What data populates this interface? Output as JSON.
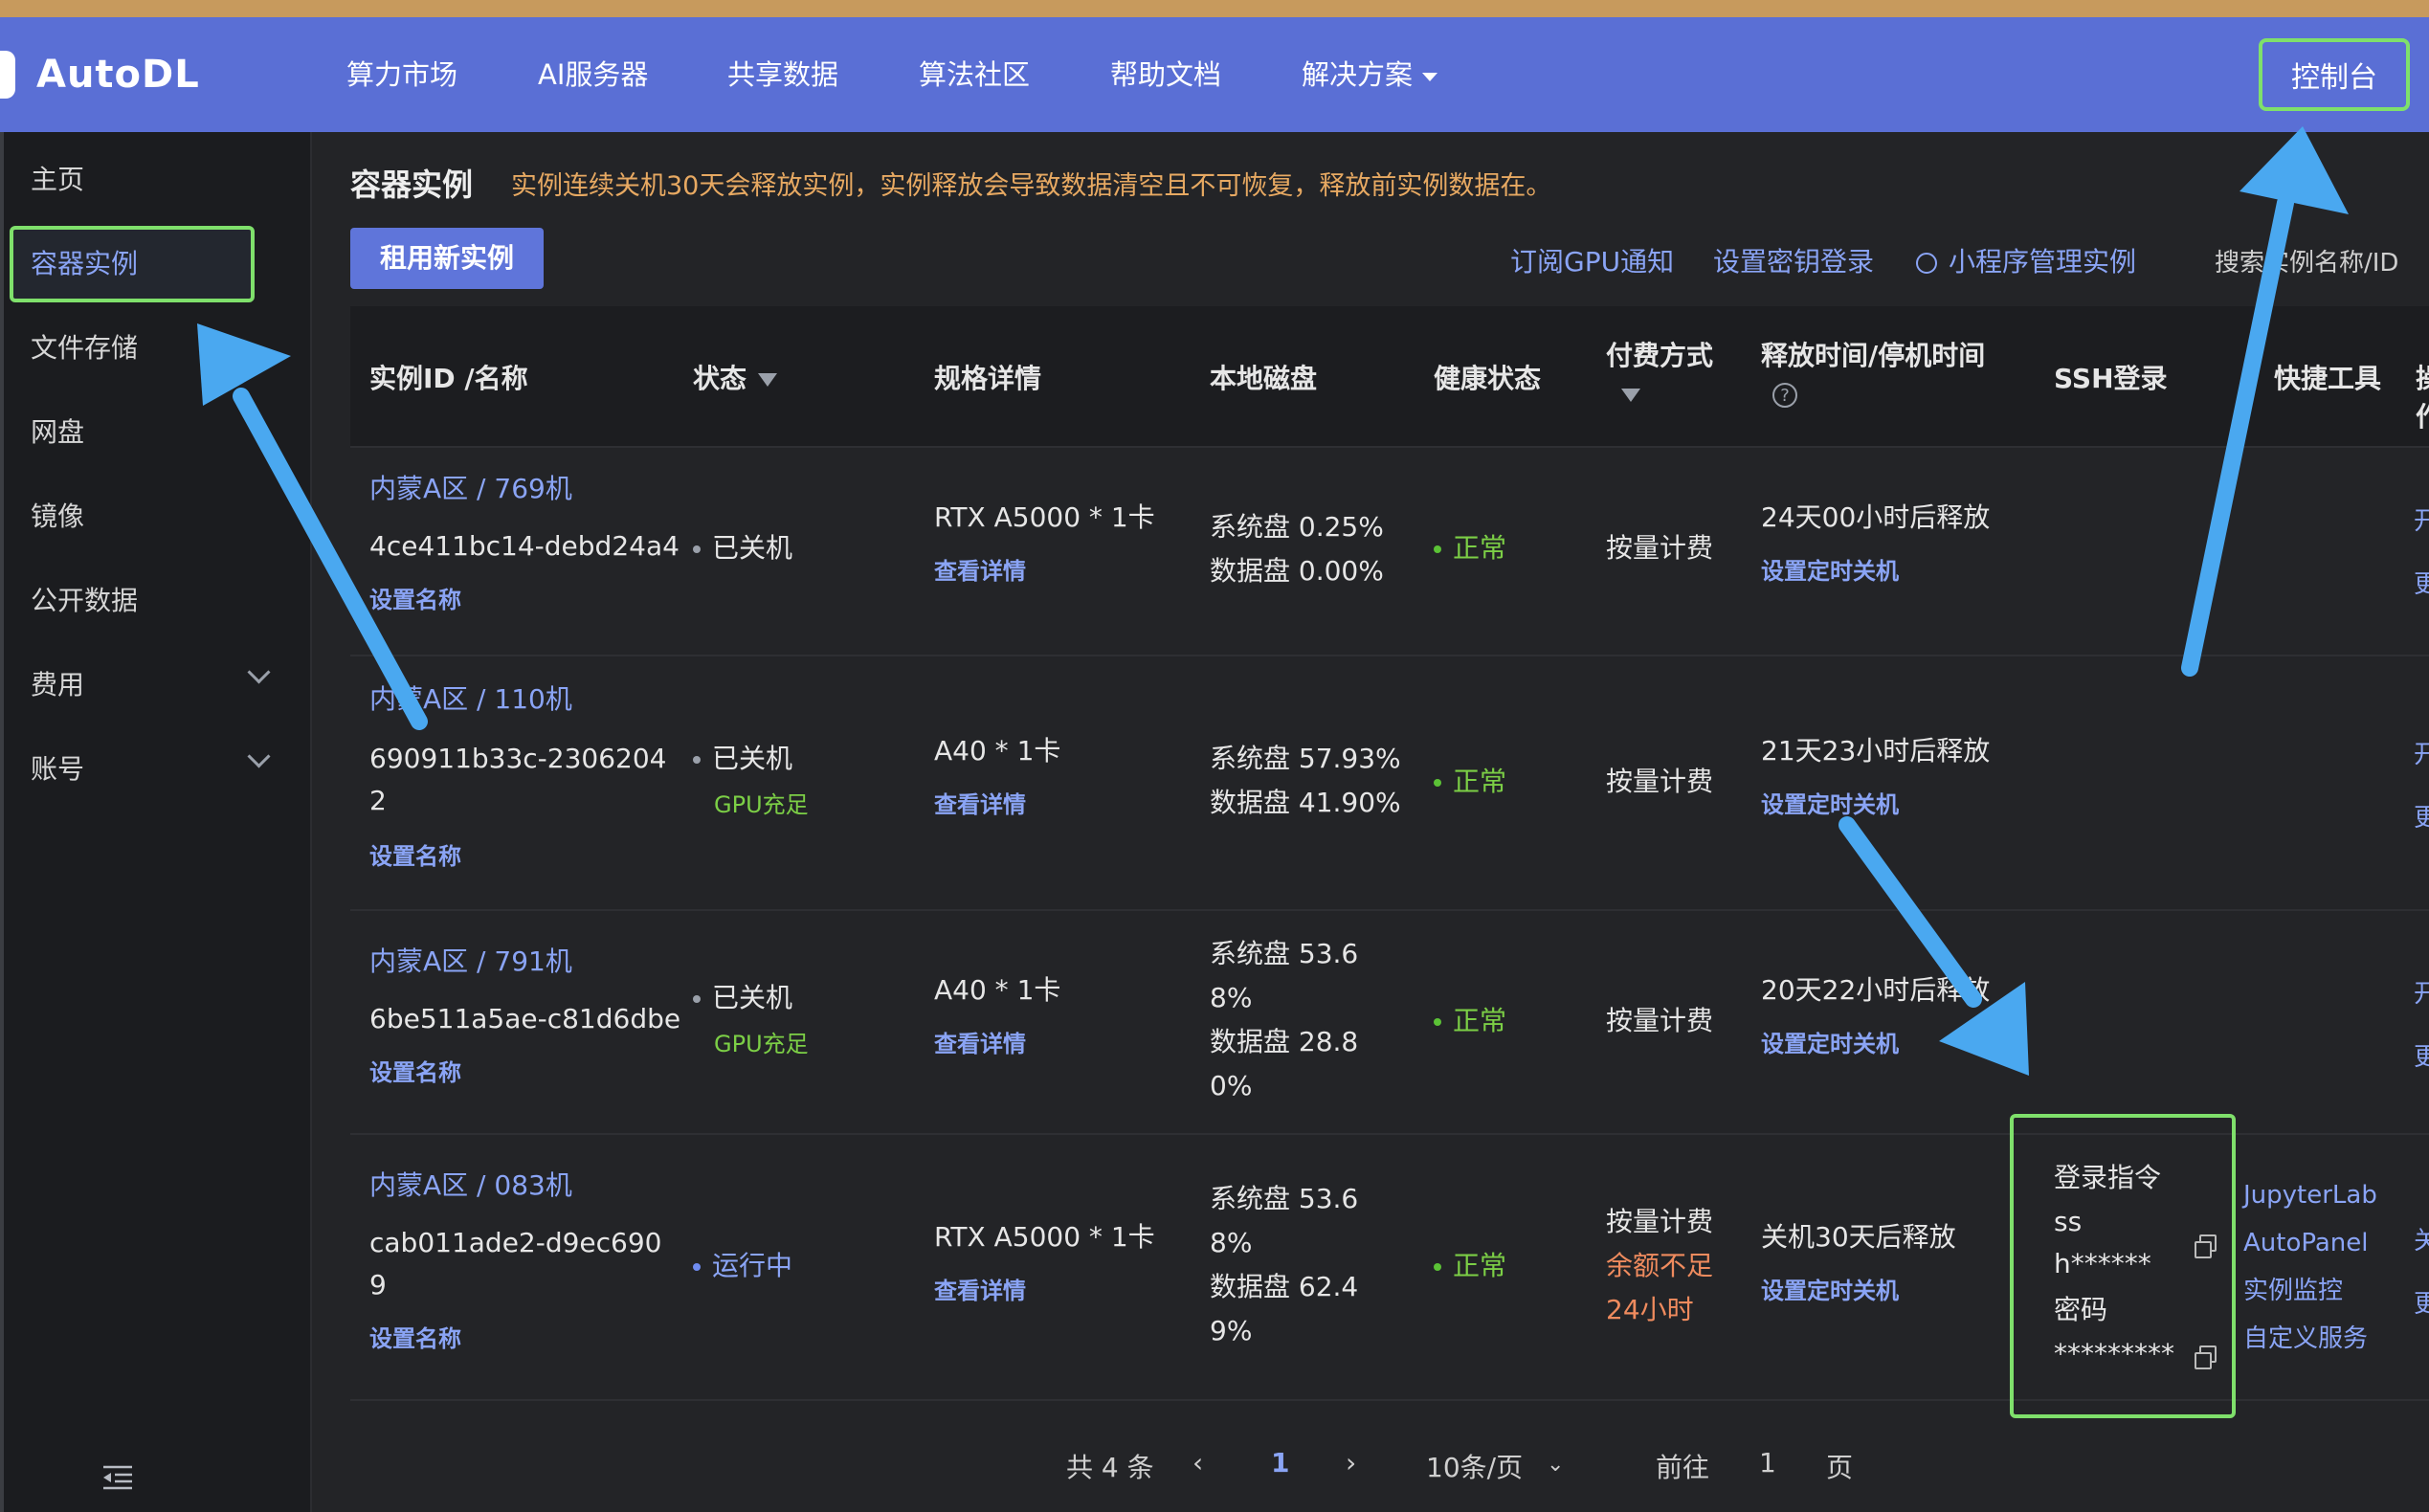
{
  "brand": {
    "name": "AutoDL"
  },
  "nav": {
    "items": [
      "算力市场",
      "AI服务器",
      "共享数据",
      "算法社区",
      "帮助文档",
      "解决方案"
    ],
    "console": "控制台"
  },
  "sidebar": {
    "items": [
      {
        "label": "主页",
        "has_submenu": false
      },
      {
        "label": "容器实例",
        "has_submenu": false,
        "active": true
      },
      {
        "label": "文件存储",
        "has_submenu": false
      },
      {
        "label": "网盘",
        "has_submenu": false
      },
      {
        "label": "镜像",
        "has_submenu": false
      },
      {
        "label": "公开数据",
        "has_submenu": false
      },
      {
        "label": "费用",
        "has_submenu": true
      },
      {
        "label": "账号",
        "has_submenu": true
      }
    ]
  },
  "header": {
    "title": "容器实例",
    "notice": "实例连续关机30天会释放实例，实例释放会导致数据清空且不可恢复，释放前实例数据在。",
    "new_instance": "租用新实例",
    "links": [
      "订阅GPU通知",
      "设置密钥登录",
      "小程序管理实例"
    ],
    "search_label": "搜索实例名称/ID"
  },
  "table": {
    "columns": {
      "id": "实例ID /名称",
      "status": "状态",
      "spec": "规格详情",
      "disk": "本地磁盘",
      "health": "健康状态",
      "billing": "付费方式",
      "release": "释放时间/停机时间",
      "ssh": "SSH登录",
      "tools": "快捷工具",
      "ops": "操作"
    },
    "rows": [
      {
        "name": "内蒙A区 / 769机",
        "id_line1": "4ce411bc14-debd24a4",
        "id_line2": "",
        "rename": "设置名称",
        "status": "已关机",
        "status_note": "",
        "spec": "RTX A5000 * 1卡",
        "spec_link": "查看详情",
        "disk": [
          "系统盘 0.25%",
          "数据盘 0.00%"
        ],
        "health": "正常",
        "billing": [
          "按量计费"
        ],
        "release": "24天00小时后释放",
        "release_link": "设置定时关机"
      },
      {
        "name": "内蒙A区 / 110机",
        "id_line1": "690911b33c-2306204",
        "id_line2": "2",
        "rename": "设置名称",
        "status": "已关机",
        "status_note": "GPU充足",
        "spec": "A40 * 1卡",
        "spec_link": "查看详情",
        "disk": [
          "系统盘 57.93%",
          "数据盘 41.90%"
        ],
        "health": "正常",
        "billing": [
          "按量计费"
        ],
        "release": "21天23小时后释放",
        "release_link": "设置定时关机"
      },
      {
        "name": "内蒙A区 / 791机",
        "id_line1": "6be511a5ae-c81d6dbe",
        "id_line2": "",
        "rename": "设置名称",
        "status": "已关机",
        "status_note": "GPU充足",
        "spec": "A40 * 1卡",
        "spec_link": "查看详情",
        "disk": [
          "系统盘 53.6",
          "8%",
          "数据盘 28.8",
          "0%"
        ],
        "health": "正常",
        "billing": [
          "按量计费"
        ],
        "release": "20天22小时后释放",
        "release_link": "设置定时关机"
      },
      {
        "name": "内蒙A区 / 083机",
        "id_line1": "cab011ade2-d9ec690",
        "id_line2": "9",
        "rename": "设置名称",
        "status": "运行中",
        "status_note": "",
        "spec": "RTX A5000 * 1卡",
        "spec_link": "查看详情",
        "disk": [
          "系统盘 53.6",
          "8%",
          "数据盘 62.4",
          "9%"
        ],
        "health": "正常",
        "billing": [
          "按量计费",
          "余额不足",
          "24小时"
        ],
        "release": "关机30天后释放",
        "release_link": "设置定时关机",
        "ssh": {
          "cmd_label": "登录指令",
          "cmd_line1": "ss",
          "cmd_line2": "h******",
          "pwd_label": "密码",
          "pwd_value": "*********"
        },
        "tools": [
          "JupyterLab",
          "AutoPanel",
          "实例监控",
          "自定义服务"
        ]
      }
    ],
    "edge_ops": [
      "开",
      "更",
      "开",
      "更",
      "开",
      "更",
      "关",
      "更"
    ]
  },
  "pagination": {
    "total": "共 4 条",
    "current": "1",
    "page_size": "10条/页",
    "goto_prefix": "前往",
    "goto_value": "1",
    "goto_suffix": "页"
  },
  "colors": {
    "nav_bg": "#5a6fd5",
    "accent": "#8aa4f5",
    "highlight_box": "#7fe06b",
    "arrow": "#4aa8f0",
    "ok": "#7ccf46",
    "warn": "#ef8b5e"
  }
}
